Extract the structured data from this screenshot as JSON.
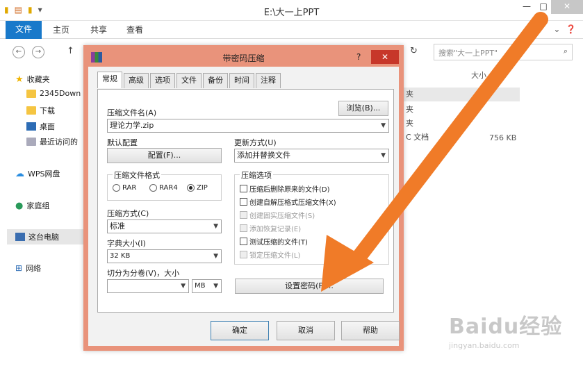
{
  "explorer": {
    "title": "E:\\大一上PPT",
    "ribbon_tabs": [
      "文件",
      "主页",
      "共享",
      "查看"
    ],
    "search_placeholder": "搜索\"大一上PPT\"",
    "nav": {
      "favorites": "收藏夹",
      "items": [
        "2345Down",
        "下载",
        "桌面",
        "最近访问的"
      ],
      "wps": "WPS网盘",
      "homegroup": "家庭组",
      "this_pc": "这台电脑",
      "network": "网络"
    },
    "file_list": {
      "size_header": "大小",
      "rows": [
        "夹",
        "夹",
        "夹",
        "C 文档"
      ],
      "file_size": "756 KB"
    }
  },
  "dialog": {
    "title": "带密码压缩",
    "help": "?",
    "close": "✕",
    "tabs": [
      "常规",
      "高级",
      "选项",
      "文件",
      "备份",
      "时间",
      "注释"
    ],
    "archive_name_label": "压缩文件名(A)",
    "browse_button": "浏览(B)...",
    "archive_name_value": "理论力学.zip",
    "default_profile_label": "默认配置",
    "profile_button": "配置(F)...",
    "update_mode_label": "更新方式(U)",
    "update_mode_value": "添加并替换文件",
    "format_group_title": "压缩文件格式",
    "formats": [
      {
        "label": "RAR",
        "selected": false
      },
      {
        "label": "RAR4",
        "selected": false
      },
      {
        "label": "ZIP",
        "selected": true
      }
    ],
    "options_group_title": "压缩选项",
    "options": [
      {
        "label": "压缩后删除原来的文件(D)",
        "disabled": false
      },
      {
        "label": "创建自解压格式压缩文件(X)",
        "disabled": false
      },
      {
        "label": "创建固实压缩文件(S)",
        "disabled": true
      },
      {
        "label": "添加恢复记录(E)",
        "disabled": true
      },
      {
        "label": "测试压缩的文件(T)",
        "disabled": false
      },
      {
        "label": "锁定压缩文件(L)",
        "disabled": true
      }
    ],
    "method_label": "压缩方式(C)",
    "method_value": "标准",
    "dict_label": "字典大小(I)",
    "dict_value": "32 KB",
    "split_label": "切分为分卷(V)，大小",
    "split_value": "",
    "split_unit": "MB",
    "set_password_button": "设置密码(P)...",
    "ok_button": "确定",
    "cancel_button": "取消",
    "help_button": "帮助"
  },
  "watermark": {
    "logo": "Baidu经验",
    "url": "jingyan.baidu.com"
  },
  "colors": {
    "annotation_arrow": "#f07b28",
    "dialog_border": "#e9937b",
    "ribbon_file": "#1979ca"
  }
}
